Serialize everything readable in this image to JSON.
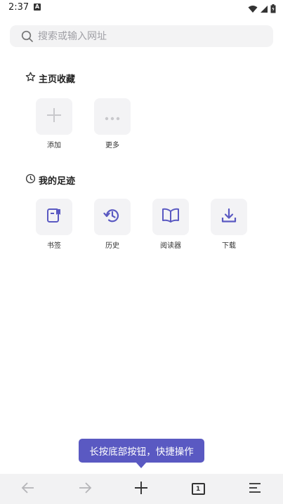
{
  "status": {
    "time": "2:37",
    "notif_badge": "A"
  },
  "search": {
    "placeholder": "搜索或输入网址"
  },
  "favorites": {
    "title": "主页收藏",
    "items": [
      {
        "label": "添加",
        "icon": "plus-icon"
      },
      {
        "label": "更多",
        "icon": "more-dots-icon"
      }
    ]
  },
  "footprints": {
    "title": "我的足迹",
    "items": [
      {
        "label": "书签",
        "icon": "bookmark-icon"
      },
      {
        "label": "历史",
        "icon": "history-icon"
      },
      {
        "label": "阅读器",
        "icon": "reader-book-icon"
      },
      {
        "label": "下载",
        "icon": "download-icon"
      }
    ]
  },
  "tooltip": {
    "text": "长按底部按钮，快捷操作"
  },
  "bottom_bar": {
    "tab_count": "1"
  },
  "colors": {
    "accent": "#5a59c2",
    "tile_bg": "#f3f3f5",
    "bar_bg": "#f2f2f3"
  }
}
